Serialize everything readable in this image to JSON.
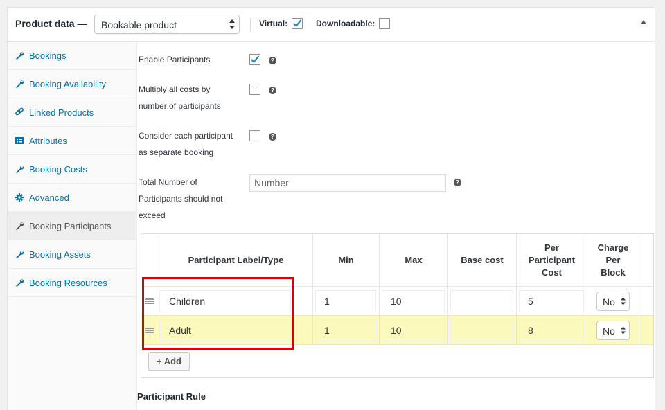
{
  "header": {
    "title": "Product data —",
    "product_type": "Bookable product",
    "virtual_label": "Virtual:",
    "virtual_checked": true,
    "downloadable_label": "Downloadable:",
    "downloadable_checked": false
  },
  "sidebar": {
    "items": [
      {
        "label": "Bookings",
        "icon": "wrench-icon"
      },
      {
        "label": "Booking Availability",
        "icon": "wrench-icon"
      },
      {
        "label": "Linked Products",
        "icon": "link-icon"
      },
      {
        "label": "Attributes",
        "icon": "list-icon"
      },
      {
        "label": "Booking Costs",
        "icon": "wrench-icon"
      },
      {
        "label": "Advanced",
        "icon": "gear-icon"
      },
      {
        "label": "Booking Participants",
        "icon": "wrench-icon",
        "active": true
      },
      {
        "label": "Booking Assets",
        "icon": "wrench-icon"
      },
      {
        "label": "Booking Resources",
        "icon": "wrench-icon"
      }
    ]
  },
  "form": {
    "enable_participants": {
      "label": "Enable Participants",
      "checked": true
    },
    "multiply_costs": {
      "line1": "Multiply all costs by",
      "line2": "number of participants",
      "checked": false
    },
    "separate_booking": {
      "line1": "Consider each participant",
      "line2": "as separate booking",
      "checked": false
    },
    "total_number": {
      "line1": "Total Number of",
      "line2": "Participants should not",
      "line3": "exceed",
      "placeholder": "Number"
    }
  },
  "table": {
    "headers": {
      "label_type": "Participant Label/Type",
      "min": "Min",
      "max": "Max",
      "base_cost": "Base cost",
      "per_participant_l1": "Per",
      "per_participant_l2": "Participant",
      "per_participant_l3": "Cost",
      "charge_l1": "Charge",
      "charge_l2": "Per",
      "charge_l3": "Block"
    },
    "rows": [
      {
        "label": "Children",
        "min": "1",
        "max": "10",
        "base_cost": "",
        "per_participant_cost": "5",
        "charge_per_block": "No"
      },
      {
        "label": "Adult",
        "min": "1",
        "max": "10",
        "base_cost": "",
        "per_participant_cost": "8",
        "charge_per_block": "No"
      }
    ],
    "add_button": "+ Add"
  },
  "participant_rule_title": "Participant Rule",
  "colors": {
    "link": "#0073aa",
    "highlight_row": "#fcf9bd",
    "annotation_box": "#e00000",
    "checkmark": "#1e8cbe"
  }
}
